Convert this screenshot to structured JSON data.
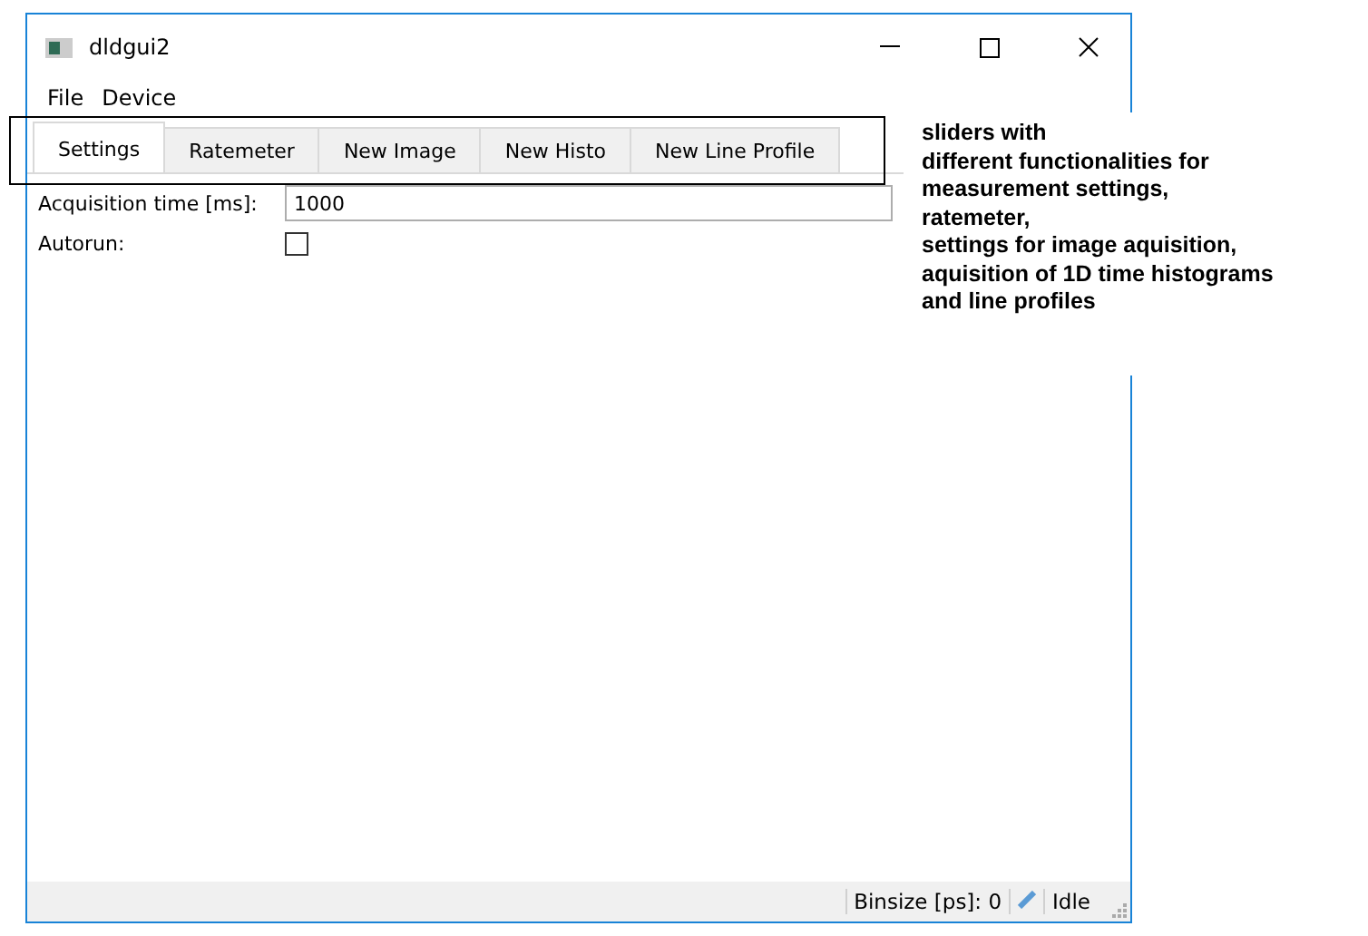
{
  "window": {
    "title": "dldgui2"
  },
  "menu": [
    "File",
    "Device"
  ],
  "tabs": [
    {
      "label": "Settings",
      "selected": true
    },
    {
      "label": "Ratemeter",
      "selected": false
    },
    {
      "label": "New Image",
      "selected": false
    },
    {
      "label": "New Histo",
      "selected": false
    },
    {
      "label": "New Line Profile",
      "selected": false
    }
  ],
  "fields": [
    {
      "kind": "text",
      "label": "Acquisition time [ms]:",
      "value": "1000"
    },
    {
      "kind": "checkbox",
      "label": "Autorun:",
      "checked": false
    }
  ],
  "status_bar": {
    "binsize": "Binsize [ps]: 0",
    "state": "Idle"
  },
  "annotation": [
    "sliders with",
    "different functionalities for",
    "measurement settings,",
    "ratemeter,",
    "settings for image aquisition,",
    "aquisition of 1D time histograms",
    "and line profiles"
  ]
}
